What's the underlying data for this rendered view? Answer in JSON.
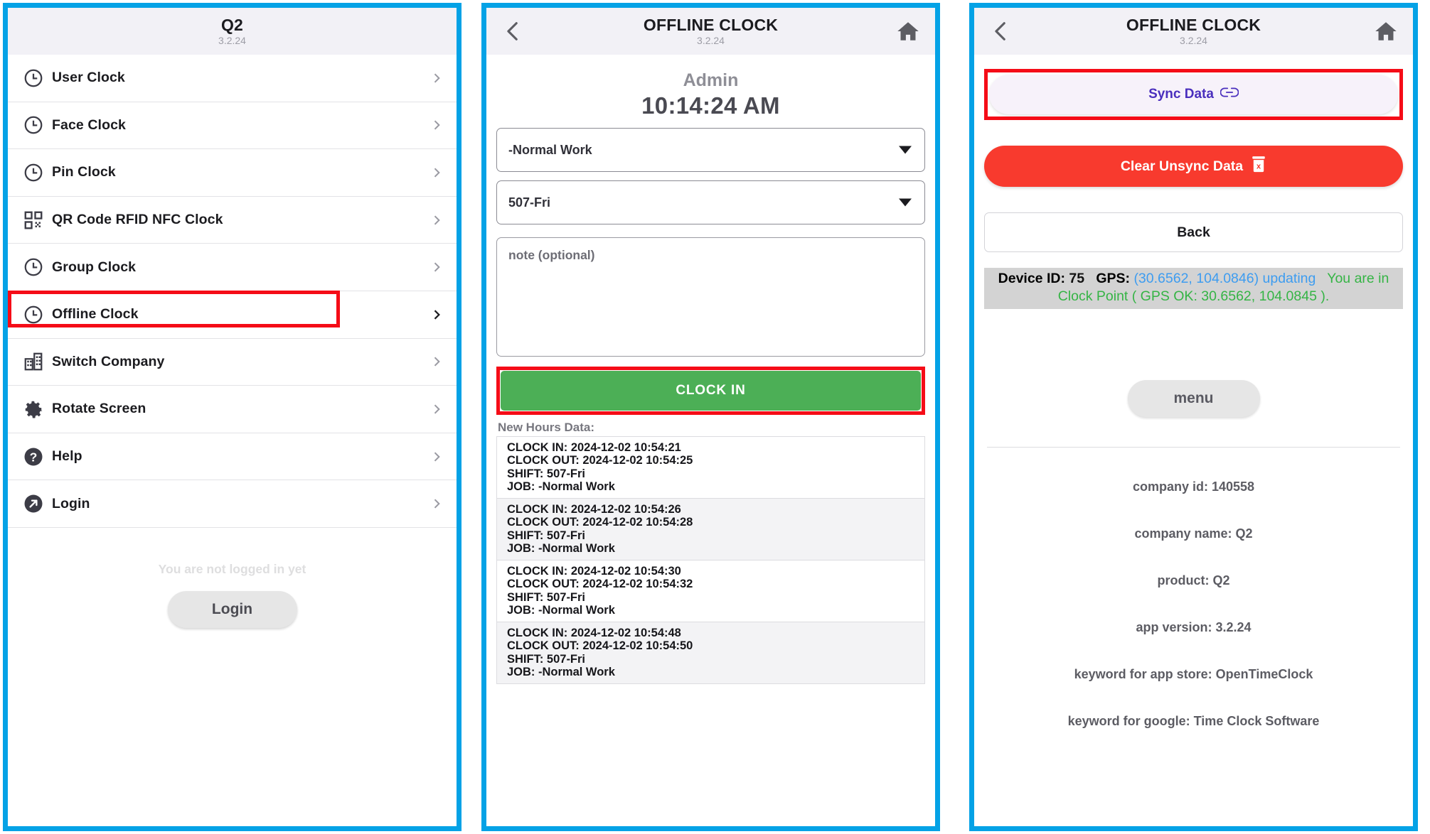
{
  "menu_screen": {
    "appbar": {
      "title": "Q2",
      "version": "3.2.24"
    },
    "items": [
      {
        "label": "User Clock",
        "icon": "clock-icon"
      },
      {
        "label": "Face Clock",
        "icon": "clock-icon"
      },
      {
        "label": "Pin Clock",
        "icon": "clock-icon"
      },
      {
        "label": "QR Code RFID NFC Clock",
        "icon": "qr-code-icon"
      },
      {
        "label": "Group Clock",
        "icon": "clock-icon"
      },
      {
        "label": "Offline Clock",
        "icon": "clock-icon"
      },
      {
        "label": "Switch Company",
        "icon": "building-icon"
      },
      {
        "label": "Rotate Screen",
        "icon": "gear-icon"
      },
      {
        "label": "Help",
        "icon": "question-circle-icon"
      },
      {
        "label": "Login",
        "icon": "arrow-up-right-circle-icon"
      }
    ],
    "footer": {
      "not_logged_in": "You are not logged in yet",
      "login_button": "Login"
    }
  },
  "clock_screen": {
    "appbar": {
      "title": "OFFLINE CLOCK",
      "version": "3.2.24"
    },
    "user": "Admin",
    "time": "10:14:24 AM",
    "job_select": "-Normal Work",
    "shift_select": "507-Fri",
    "note_placeholder": "note (optional)",
    "clock_in_button": "CLOCK IN",
    "hours_title": "New Hours Data:",
    "entries": [
      {
        "clock_in": "CLOCK IN: 2024-12-02 10:54:21",
        "clock_out": "CLOCK OUT: 2024-12-02 10:54:25",
        "shift": "SHIFT: 507-Fri",
        "job": "JOB: -Normal Work"
      },
      {
        "clock_in": "CLOCK IN: 2024-12-02 10:54:26",
        "clock_out": "CLOCK OUT: 2024-12-02 10:54:28",
        "shift": "SHIFT: 507-Fri",
        "job": "JOB: -Normal Work"
      },
      {
        "clock_in": "CLOCK IN: 2024-12-02 10:54:30",
        "clock_out": "CLOCK OUT: 2024-12-02 10:54:32",
        "shift": "SHIFT: 507-Fri",
        "job": "JOB: -Normal Work"
      },
      {
        "clock_in": "CLOCK IN: 2024-12-02 10:54:48",
        "clock_out": "CLOCK OUT: 2024-12-02 10:54:50",
        "shift": "SHIFT: 507-Fri",
        "job": "JOB: -Normal Work"
      }
    ]
  },
  "sync_screen": {
    "appbar": {
      "title": "OFFLINE CLOCK",
      "version": "3.2.24"
    },
    "sync_button": "Sync Data",
    "clear_button": "Clear Unsync Data",
    "back_button": "Back",
    "status": {
      "device_id_label": "Device ID:",
      "device_id_value": "75",
      "gps_label": "GPS:",
      "gps_value": "(30.6562, 104.0846)",
      "gps_state": "updating",
      "clock_point": "You are in Clock Point ( GPS OK: 30.6562, 104.0845 )."
    },
    "menu_button": "menu",
    "about": [
      "company id: 140558",
      "company name: Q2",
      "product: Q2",
      "app version: 3.2.24",
      "keyword for app store: OpenTimeClock",
      "keyword for google: Time Clock Software"
    ]
  },
  "colors": {
    "panel_border": "#04a2e6",
    "highlight": "#f50c17",
    "clock_in_green": "#4caf56",
    "clear_red": "#f83a2e",
    "sync_purple": "#4a2fbd",
    "gps_blue": "#3d9cf0",
    "gps_green": "#35b445"
  }
}
